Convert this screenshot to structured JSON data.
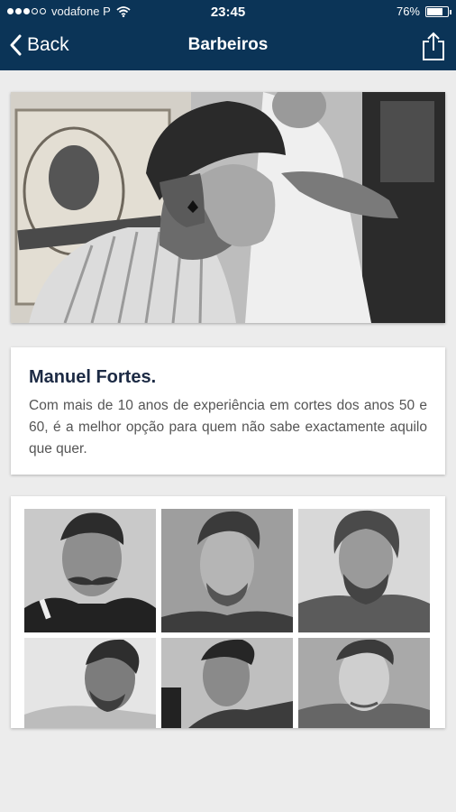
{
  "status_bar": {
    "carrier": "vodafone P",
    "time": "23:45",
    "battery": "76%",
    "battery_level": 0.76
  },
  "nav": {
    "back_label": "Back",
    "title": "Barbeiros",
    "back_icon": "chevron-left-icon",
    "share_icon": "share-icon"
  },
  "barber": {
    "name": "Manuel Fortes.",
    "description": "Com mais de 10 anos de experiência em cortes dos anos 50 e 60, é a melhor opção para quem não sabe exactamente aquilo que quer."
  },
  "colors": {
    "nav_background": "#0b3457",
    "page_background": "#ececec",
    "name_text": "#1c2a44"
  },
  "gallery": {
    "photo_count": 6
  }
}
